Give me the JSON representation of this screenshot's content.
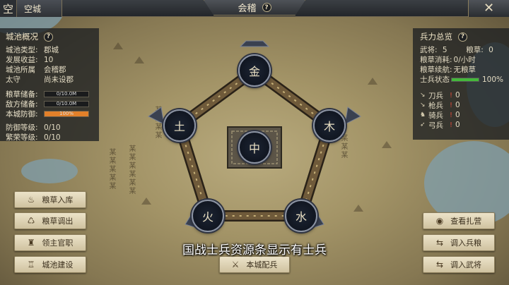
{
  "topbar": {
    "city_glyph": "空",
    "city_name": "空城",
    "title": "会稽",
    "help_label": "?"
  },
  "left_panel": {
    "title": "城池概况",
    "rows": [
      {
        "k": "城池类型:",
        "v": "郡城"
      },
      {
        "k": "发展收益:",
        "v": "10"
      },
      {
        "k": "城池所属",
        "v": "会稽郡"
      },
      {
        "k": "太守",
        "v": "尚未设郡"
      }
    ],
    "stores": [
      {
        "k": "粮草储备:",
        "v": "0/10.0M",
        "fill": 0
      },
      {
        "k": "敌方储备:",
        "v": "0/10.0M",
        "fill": 0
      },
      {
        "k": "本城防御:",
        "v": "100%",
        "fill": 1.0
      }
    ],
    "levels": [
      {
        "k": "防御等级:",
        "v": "0/10"
      },
      {
        "k": "繁荣等级:",
        "v": "0/10"
      }
    ]
  },
  "right_panel": {
    "title": "兵力总览",
    "stats": [
      {
        "k": "武将:",
        "v": "5",
        "k2": "粮草:",
        "v2": "0"
      },
      {
        "k": "粮草消耗:",
        "v": "0/小时"
      },
      {
        "k": "粮草续航:",
        "v": "无粮草"
      }
    ],
    "troop_status_label": "士兵状态",
    "troop_status_value": "100%",
    "troop_status_fill": 1.0,
    "troops": [
      {
        "icon": "sword-icon",
        "glyph": "↘",
        "name": "刀兵",
        "count": "0"
      },
      {
        "icon": "spear-icon",
        "glyph": "↘",
        "name": "枪兵",
        "count": "0"
      },
      {
        "icon": "horse-icon",
        "glyph": "♞",
        "name": "骑兵",
        "count": "0"
      },
      {
        "icon": "bow-icon",
        "glyph": "➶",
        "name": "弓兵",
        "count": "0"
      }
    ]
  },
  "pentagon": {
    "center": "中",
    "nodes": {
      "metal": "金",
      "wood": "木",
      "water": "水",
      "fire": "火",
      "earth": "土"
    }
  },
  "buttons": {
    "left": [
      "粮草入库",
      "粮草调出",
      "领主官职",
      "城池建设"
    ],
    "right": [
      "查看扎营",
      "调入兵粮",
      "调入武将"
    ],
    "center": "本城配兵"
  },
  "subtitle": "国战士兵资源条显示有士兵",
  "map_labels": [
    "某某某某某",
    "某某某某某某",
    "某某某某",
    "某某某"
  ],
  "colors": {
    "defense_bar": "#e2802a",
    "troop_bar": "#44b83a",
    "alert": "#e04a3a"
  }
}
